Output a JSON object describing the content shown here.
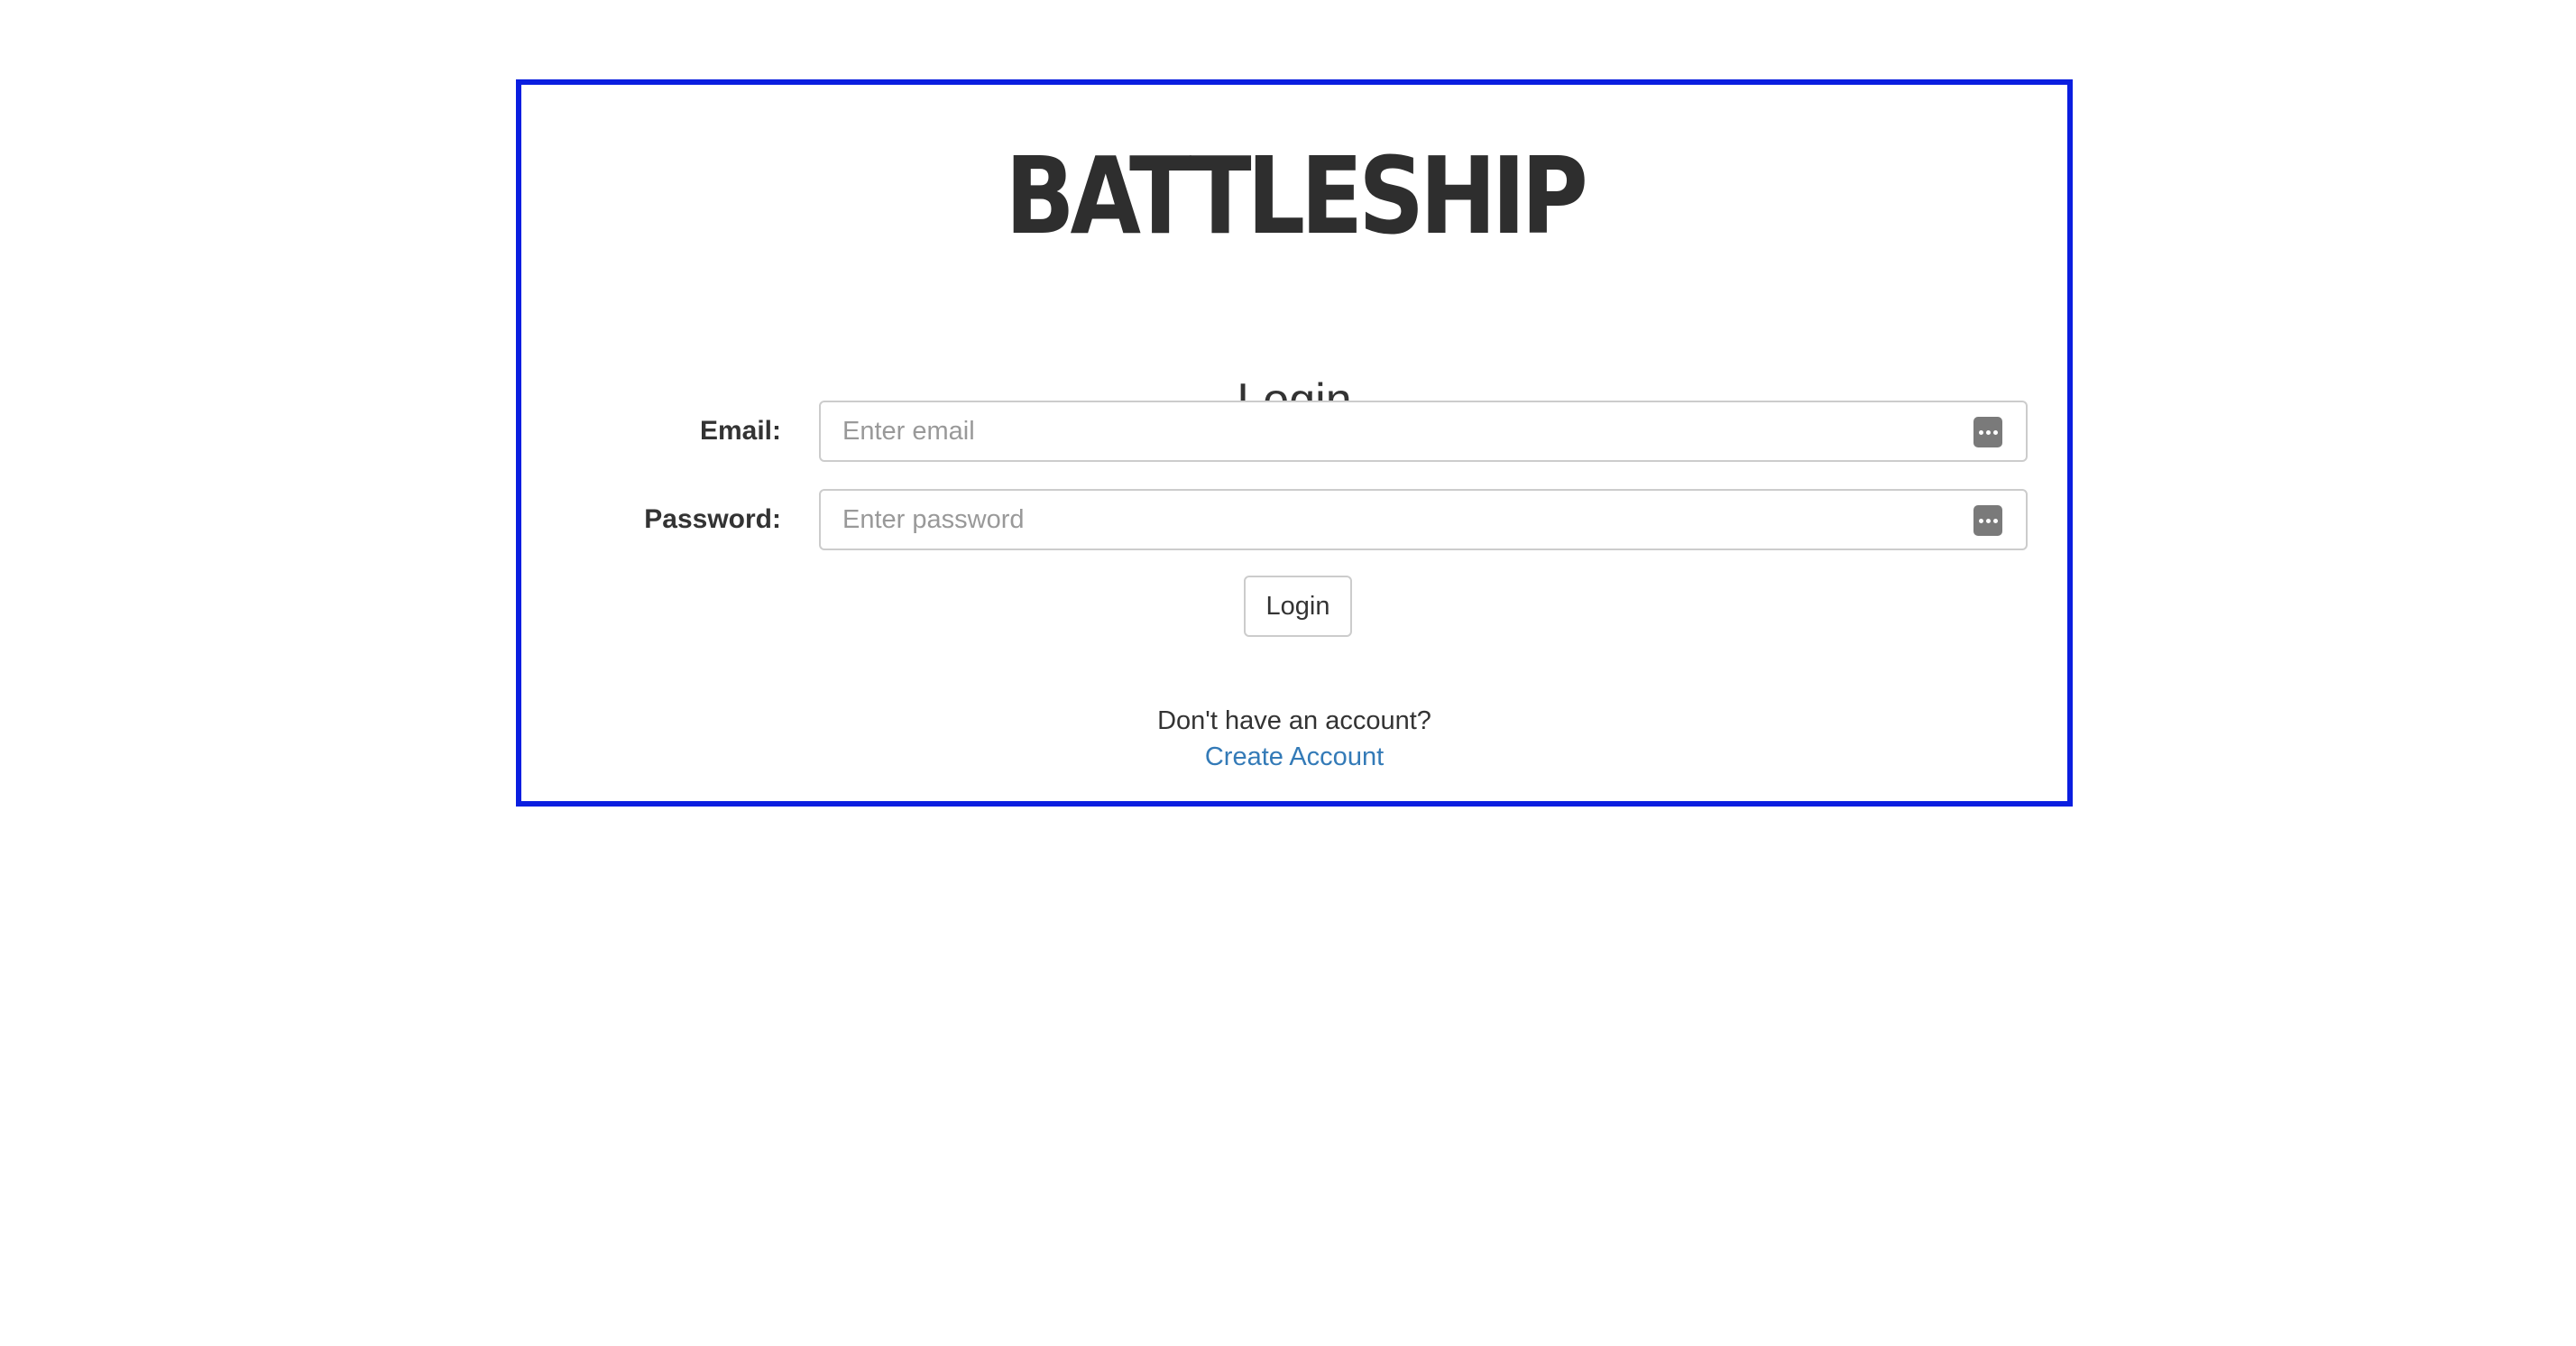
{
  "logo": {
    "text": "BATTLESHIP"
  },
  "login_form": {
    "title": "Login",
    "email": {
      "label": "Email:",
      "placeholder": "Enter email",
      "value": ""
    },
    "password": {
      "label": "Password:",
      "placeholder": "Enter password",
      "value": ""
    },
    "submit_label": "Login"
  },
  "signup": {
    "prompt": "Don't have an account?",
    "link_label": "Create Account"
  },
  "colors": {
    "panel_border": "#0a1ee0",
    "link": "#337ab7",
    "text": "#333333",
    "input_border": "#cccccc"
  },
  "icons": {
    "field_autofill": "password-manager-icon"
  }
}
